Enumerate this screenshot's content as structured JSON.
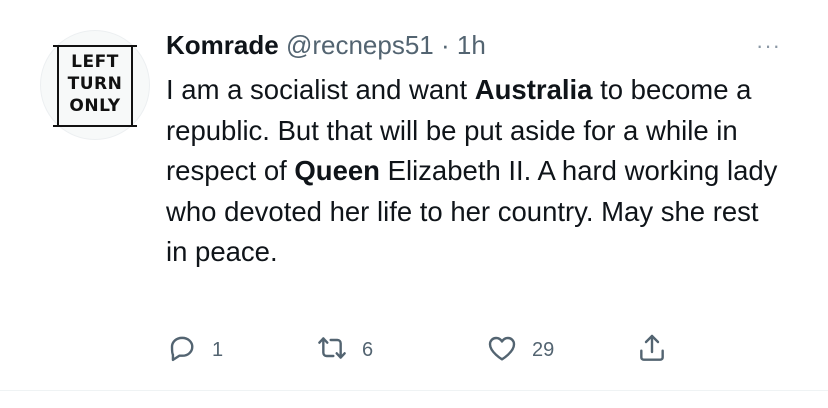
{
  "avatar": {
    "sign_lines": "LEFT\nTURN\nONLY"
  },
  "author": {
    "name": "Komrade",
    "handle": "@recneps51",
    "separator": "·",
    "time": "1h"
  },
  "more_label": "···",
  "tweet": {
    "seg1": "I am a socialist and want ",
    "bold1": "Australia",
    "seg2": " to become a republic. But that will be put aside for a while in respect of ",
    "bold2": "Queen",
    "seg3": " Elizabeth II. A hard working lady who devoted her life to her country. May she rest in peace."
  },
  "actions": {
    "reply_count": "1",
    "retweet_count": "6",
    "like_count": "29"
  },
  "icons": {
    "reply": "reply-icon",
    "retweet": "retweet-icon",
    "like": "heart-icon",
    "share": "share-icon",
    "more": "more-icon"
  },
  "colors": {
    "text": "#0f1419",
    "muted": "#536471",
    "background": "#ffffff"
  }
}
